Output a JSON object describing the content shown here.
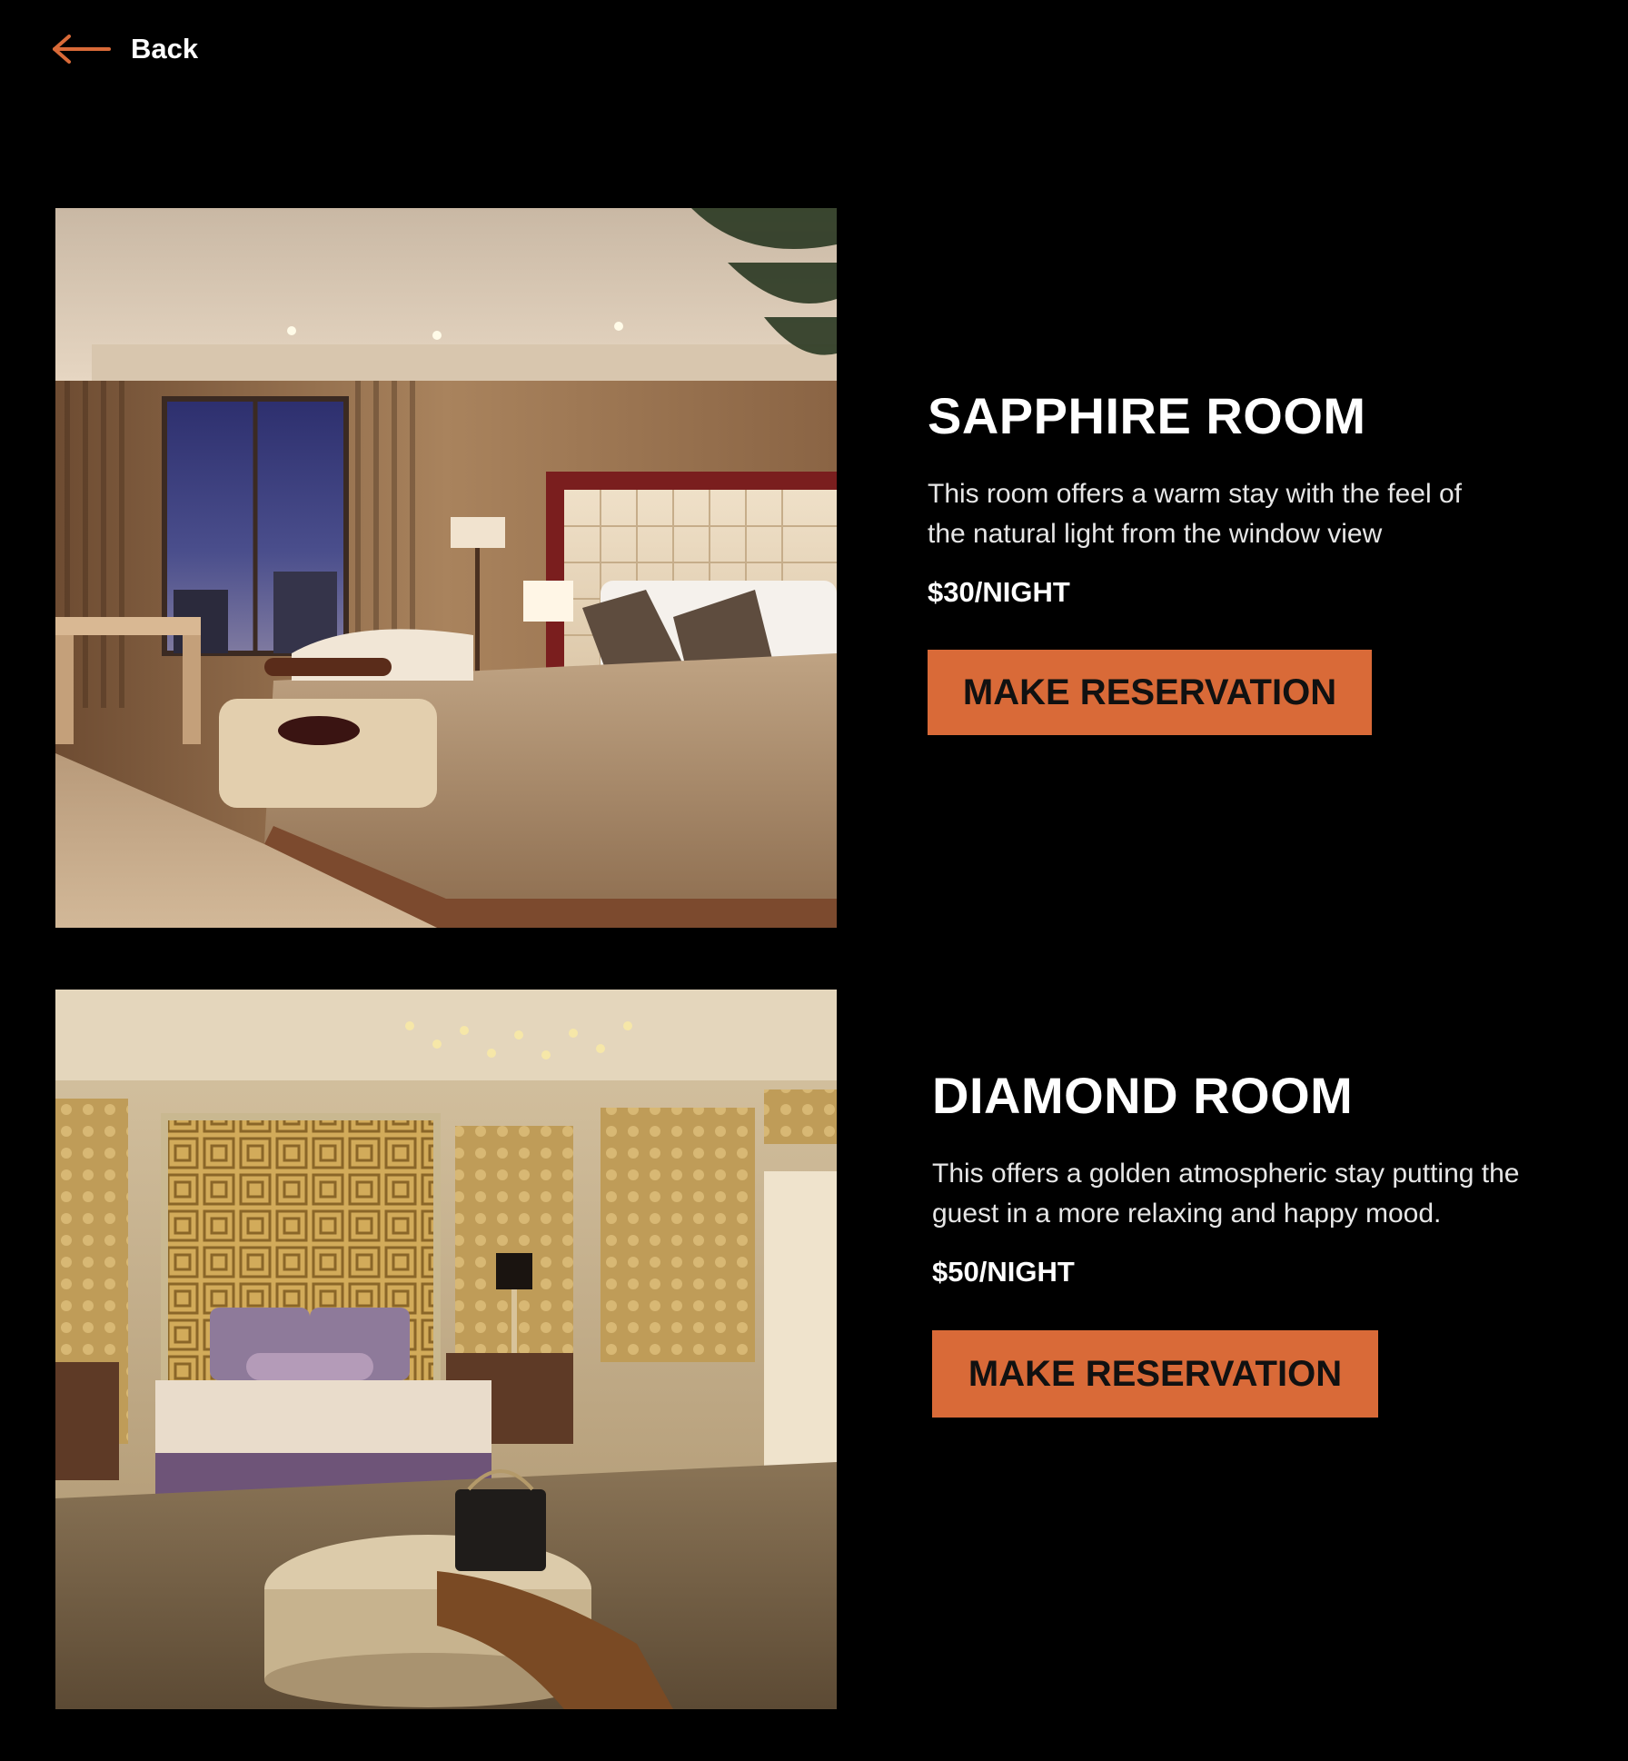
{
  "nav": {
    "back_label": "Back",
    "accent": "#d96a38"
  },
  "rooms": [
    {
      "title": "SAPPHIRE ROOM",
      "description": "This room offers a warm stay with the feel of the natural light from the window view",
      "price": "$30/NIGHT",
      "button_label": "MAKE RESERVATION",
      "image_alt": "sapphire-room-photo"
    },
    {
      "title": "DIAMOND ROOM",
      "description": "This offers a golden atmospheric stay putting the guest in a more relaxing and happy mood.",
      "price": "$50/NIGHT",
      "button_label": "MAKE RESERVATION",
      "image_alt": "diamond-room-photo"
    }
  ],
  "colors": {
    "background": "#000000",
    "button": "#d96a38",
    "button_text": "#111111",
    "text": "#ffffff"
  }
}
